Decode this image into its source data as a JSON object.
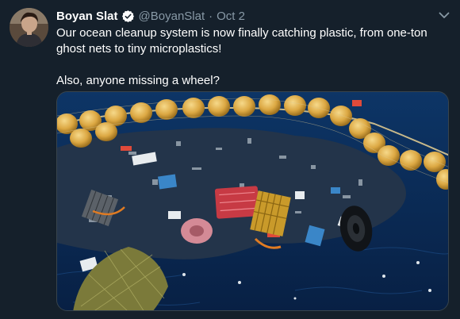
{
  "tweet": {
    "display_name": "Boyan Slat",
    "handle": "@BoyanSlat",
    "separator": "·",
    "date": "Oct 2",
    "text": "Our ocean cleanup system is now finally catching plastic, from one-ton ghost nets to tiny microplastics!\n\nAlso, anyone missing a wheel?"
  },
  "icons": {
    "verified": "verified-badge-icon",
    "menu": "chevron-down-icon"
  },
  "colors": {
    "background": "#15202b",
    "secondary_text": "#8899a6",
    "verified_blue": "#1da1f2",
    "ocean": "#0b2a4d",
    "buoy": "#e2b34a"
  }
}
